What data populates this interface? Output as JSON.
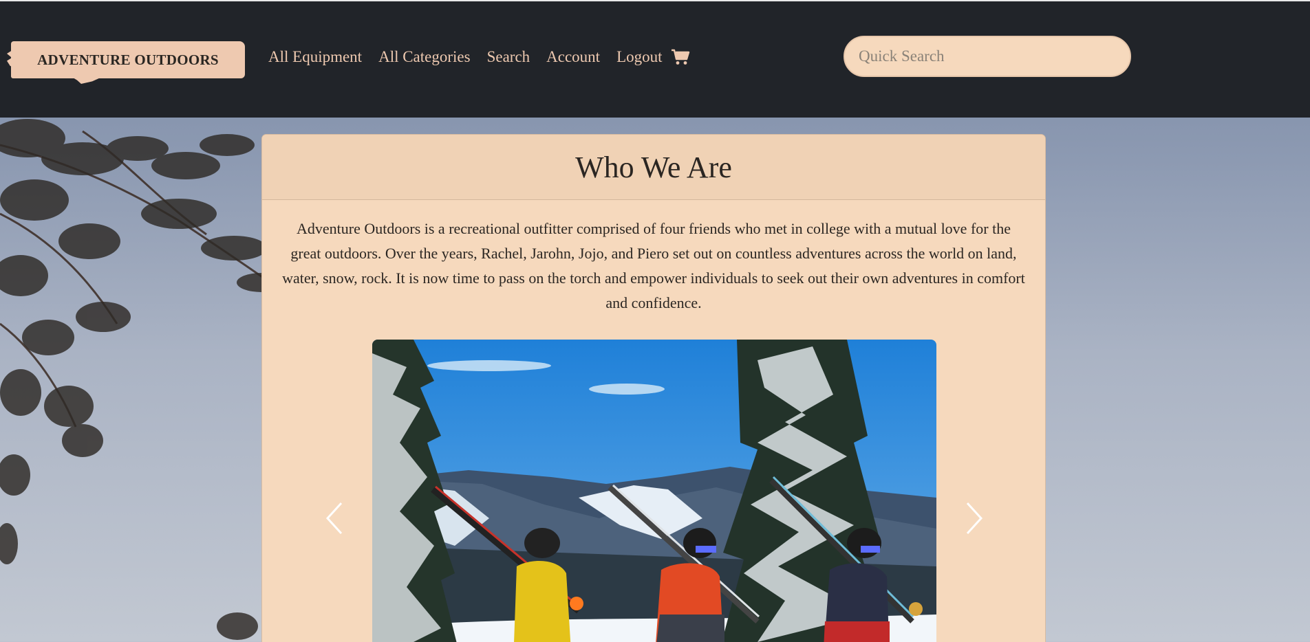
{
  "brand": {
    "name": "ADVENTURE OUTDOORS"
  },
  "nav": {
    "links": [
      "All Equipment",
      "All Categories",
      "Search",
      "Account",
      "Logout"
    ],
    "cart_icon": "shopping-cart-icon"
  },
  "search": {
    "placeholder": "Quick Search"
  },
  "about": {
    "title": "Who We Are",
    "body": "Adventure Outdoors is a recreational outfitter comprised of four friends who met in college with a mutual love for the great outdoors. Over the years, Rachel, Jarohn, Jojo, and Piero set out on countless adventures across the world on land, water, snow, rock. It is now time to pass on the torch and empower individuals to seek out their own adventures in comfort and confidence."
  },
  "carousel": {
    "prev_icon": "chevron-left-icon",
    "next_icon": "chevron-right-icon",
    "photo": "skiers-carrying-skis-photo"
  },
  "colors": {
    "navbar": "#212429",
    "accent": "#eec9b0",
    "card": "#f6d9bd",
    "card_header": "#f0d2b5",
    "text": "#2b2622"
  }
}
